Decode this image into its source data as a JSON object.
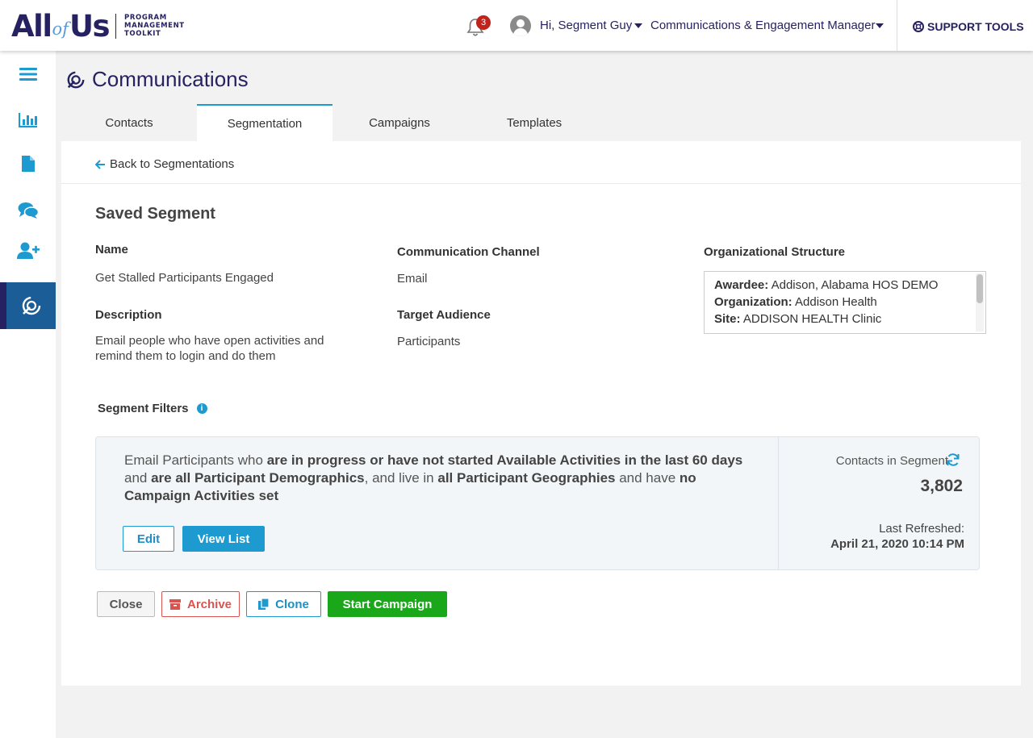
{
  "header": {
    "logo_all": "All",
    "logo_of": "of",
    "logo_us": "Us",
    "logo_sub": [
      "PROGRAM",
      "MANAGEMENT",
      "TOOLKIT"
    ],
    "notifications_count": "3",
    "greeting": "Hi, Segment Guy",
    "role": "Communications & Engagement Manager",
    "support_label": "SUPPORT TOOLS"
  },
  "sidebar": {
    "items": [
      {
        "icon": "menu-icon"
      },
      {
        "icon": "chart-icon"
      },
      {
        "icon": "document-icon"
      },
      {
        "icon": "chat-icon"
      },
      {
        "icon": "add-user-icon"
      },
      {
        "icon": "communications-icon",
        "active": true
      }
    ]
  },
  "page": {
    "title": "Communications",
    "tabs": [
      {
        "label": "Contacts",
        "active": false
      },
      {
        "label": "Segmentation",
        "active": true
      },
      {
        "label": "Campaigns",
        "active": false
      },
      {
        "label": "Templates",
        "active": false
      }
    ]
  },
  "segment": {
    "back_label": "Back to Segmentations",
    "section_title": "Saved Segment",
    "name_label": "Name",
    "name_value": "Get Stalled Participants Engaged",
    "description_label": "Description",
    "description_value": "Email people who have open activities and remind them to login and do them",
    "channel_label": "Communication Channel",
    "channel_value": "Email",
    "audience_label": "Target Audience",
    "audience_value": "Participants",
    "org_label": "Organizational Structure",
    "org": {
      "awardee_label": "Awardee:",
      "awardee_value": "Addison, Alabama HOS DEMO",
      "organization_label": "Organization:",
      "organization_value": "Addison Health",
      "site_label": "Site:",
      "site_value": "ADDISON HEALTH Clinic"
    }
  },
  "filters": {
    "label": "Segment Filters",
    "text_1": "Email Participants who ",
    "bold_1": "are in progress or have not started Available Activities in the last 60 days",
    "text_2": " and ",
    "bold_2": "are all Participant Demographics",
    "text_3": ", and live in ",
    "bold_3": "all Participant Geographies",
    "text_4": " and have ",
    "bold_4": "no Campaign Activities set",
    "edit_label": "Edit",
    "view_list_label": "View List",
    "contacts_label": "Contacts in Segment",
    "contacts_count": "3,802",
    "last_refreshed_label": "Last Refreshed:",
    "last_refreshed_value": "April 21, 2020 10:14 PM"
  },
  "actions": {
    "close_label": "Close",
    "archive_label": "Archive",
    "clone_label": "Clone",
    "start_label": "Start Campaign"
  },
  "colors": {
    "brand_navy": "#262262",
    "accent_blue": "#1d9bd1",
    "active_sidebar": "#1b5d97",
    "danger_red": "#d9534f",
    "success_green": "#1aa81a",
    "badge_red": "#c0221c"
  }
}
